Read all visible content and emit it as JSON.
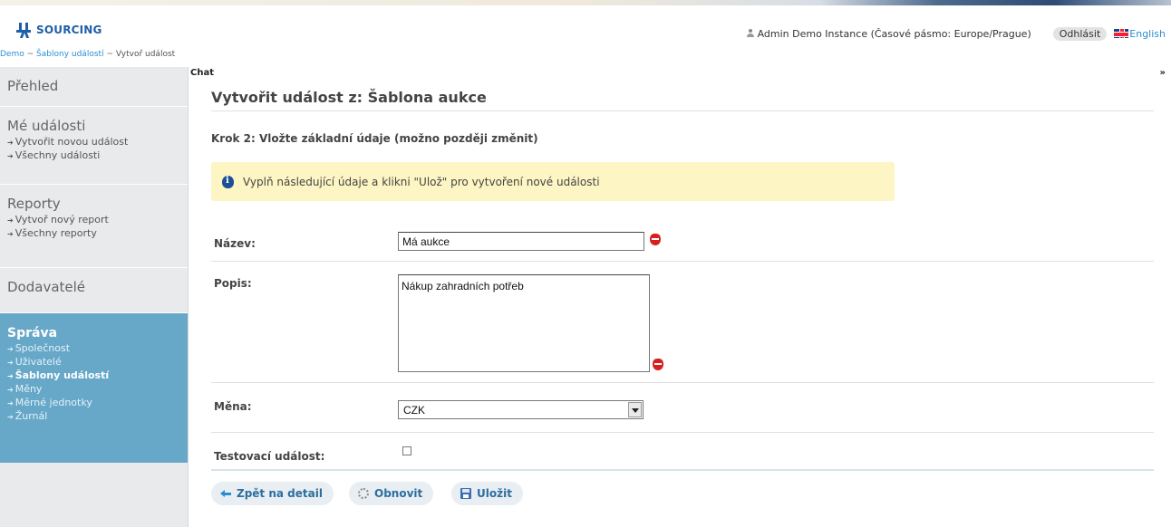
{
  "header": {
    "logo_text": "SOURCING",
    "user_info": "Admin Demo Instance (Časové pásmo: Europe/Prague)",
    "logout_label": "Odhlásit",
    "language_label": "English"
  },
  "breadcrumb": {
    "items": [
      "Demo",
      "Šablony událostí"
    ],
    "separator": "~",
    "current": "Vytvoř událost"
  },
  "sidebar": {
    "overview": "Přehled",
    "my_events": {
      "title": "Mé události",
      "items": [
        "Vytvořit novou událost",
        "Všechny události"
      ]
    },
    "reports": {
      "title": "Reporty",
      "items": [
        "Vytvoř nový report",
        "Všechny reporty"
      ]
    },
    "suppliers": "Dodavatelé",
    "admin": {
      "title": "Správa",
      "items": [
        "Společnost",
        "Uživatelé",
        "Šablony událostí",
        "Měny",
        "Měrné jednotky",
        "Žurnál"
      ],
      "selected": "Šablony událostí"
    }
  },
  "chat": {
    "label": "Chat",
    "toggle": "»"
  },
  "main": {
    "title": "Vytvořit událost z: Šablona aukce",
    "step": "Krok 2: Vložte základní údaje (možno později změnit)",
    "info": "Vyplň následující údaje a klikni \"Ulož\" pro vytvoření nové události",
    "fields": {
      "name_label": "Název:",
      "name_value": "Má aukce",
      "description_label": "Popis:",
      "description_value": "Nákup zahradních potřeb",
      "currency_label": "Měna:",
      "currency_value": "CZK",
      "test_label": "Testovací událost:"
    },
    "buttons": {
      "back": "Zpět na detail",
      "refresh": "Obnovit",
      "save": "Uložit"
    }
  },
  "colors": {
    "accent": "#2a8fd0",
    "sidebar_active": "#67a8c9",
    "info_bg": "#fdf5c3",
    "required": "#d62020"
  }
}
